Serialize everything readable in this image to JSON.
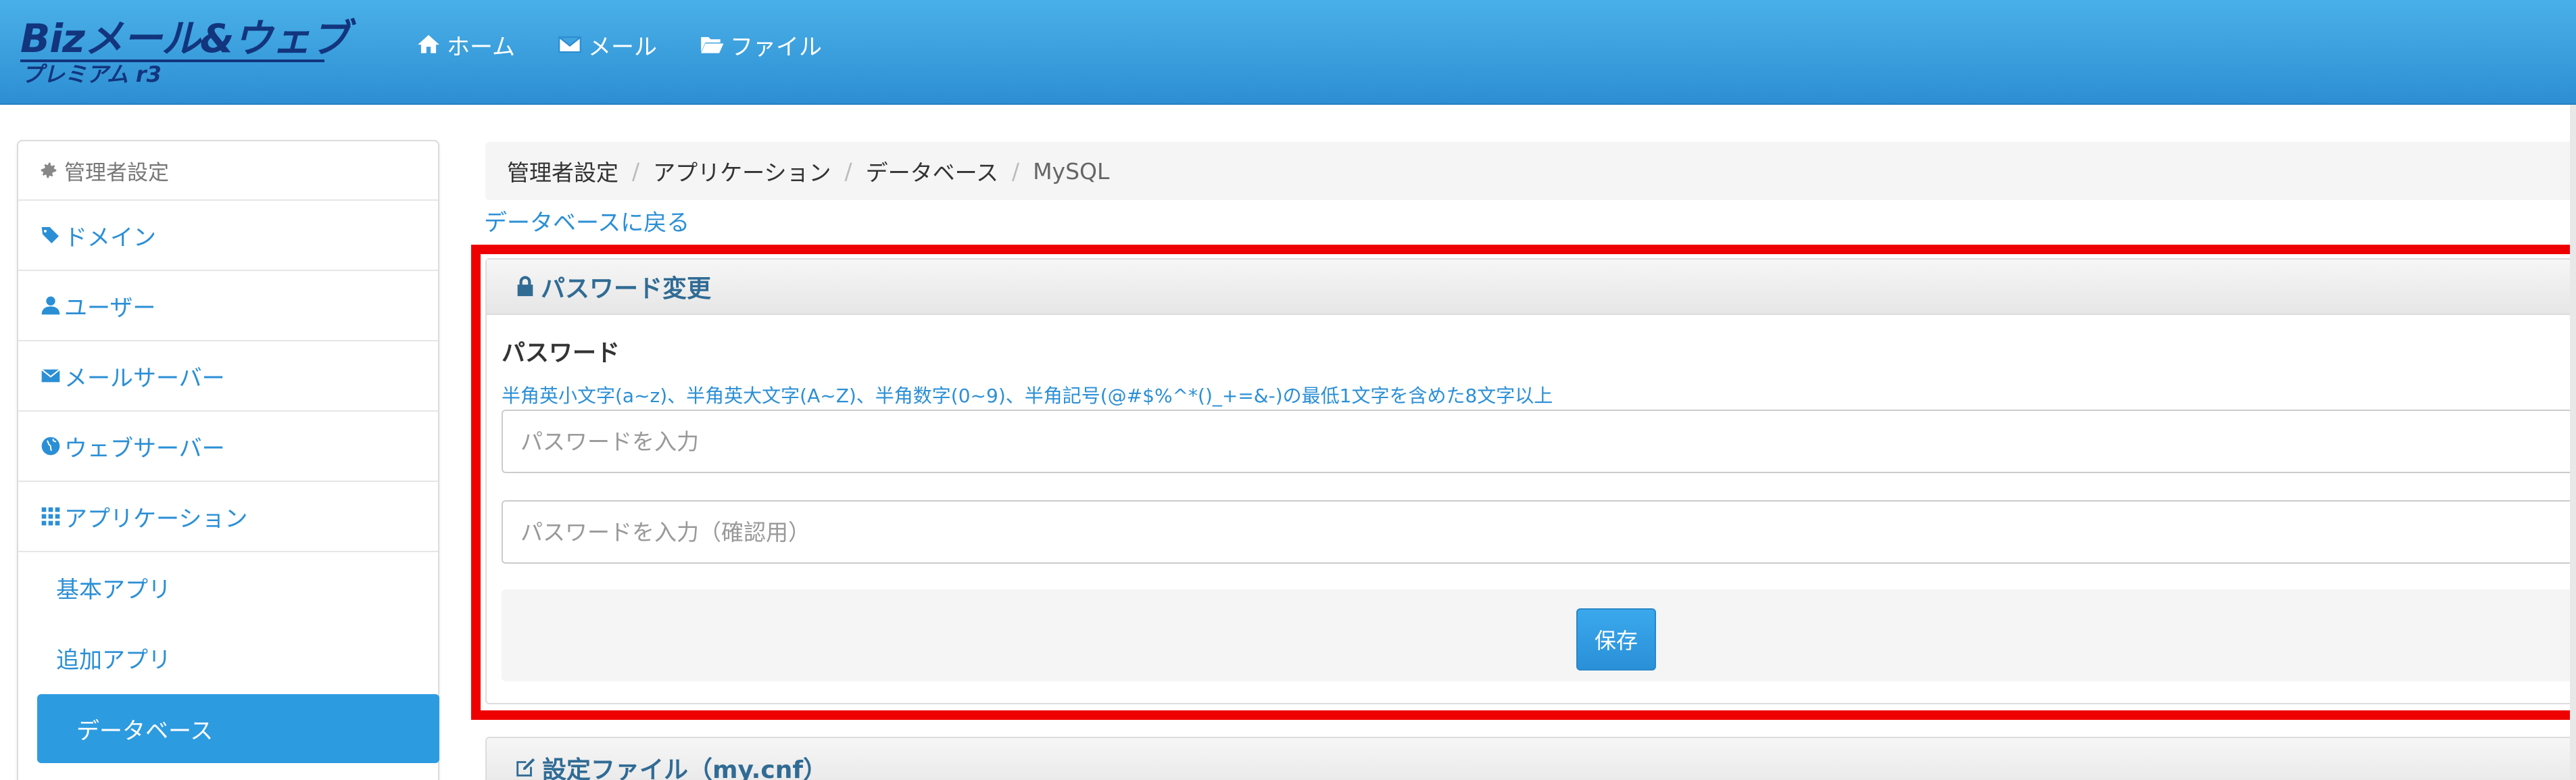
{
  "header": {
    "logo_main": "Bizメール&ウェブ",
    "logo_sub": "プレミアム r3",
    "nav": [
      {
        "label": "ホーム",
        "icon": "home-icon"
      },
      {
        "label": "メール",
        "icon": "envelope-icon"
      },
      {
        "label": "ファイル",
        "icon": "folder-open-icon"
      }
    ]
  },
  "sidebar": {
    "header": "管理者設定",
    "items": [
      {
        "label": "ドメイン",
        "icon": "tags-icon"
      },
      {
        "label": "ユーザー",
        "icon": "user-icon"
      },
      {
        "label": "メールサーバー",
        "icon": "envelope-icon"
      },
      {
        "label": "ウェブサーバー",
        "icon": "globe-icon"
      },
      {
        "label": "アプリケーション",
        "icon": "grid-icon"
      }
    ],
    "sub_items": [
      {
        "label": "基本アプリ"
      },
      {
        "label": "追加アプリ"
      },
      {
        "label": "データベース",
        "active": true
      }
    ]
  },
  "breadcrumb": [
    "管理者設定",
    "アプリケーション",
    "データベース",
    "MySQL"
  ],
  "back_link": "データベースに戻る",
  "password_panel": {
    "title": "パスワード変更",
    "icon": "lock-icon",
    "field_label": "パスワード",
    "help_text": "半角英小文字(a~z)、半角英大文字(A~Z)、半角数字(0~9)、半角記号(@#$%^*()_+=&-)の最低1文字を含めた8文字以上",
    "input1_placeholder": "パスワードを入力",
    "input2_placeholder": "パスワードを入力（確認用）",
    "save_label": "保存"
  },
  "config_panel": {
    "title": "設定ファイル（my.cnf）",
    "icon": "edit-icon"
  },
  "colors": {
    "header_blue": "#2d8fd3",
    "link_blue": "#2b8fd6",
    "active_blue": "#2d9be0",
    "highlight_red": "#ee0000",
    "logo_navy": "#12357e"
  }
}
